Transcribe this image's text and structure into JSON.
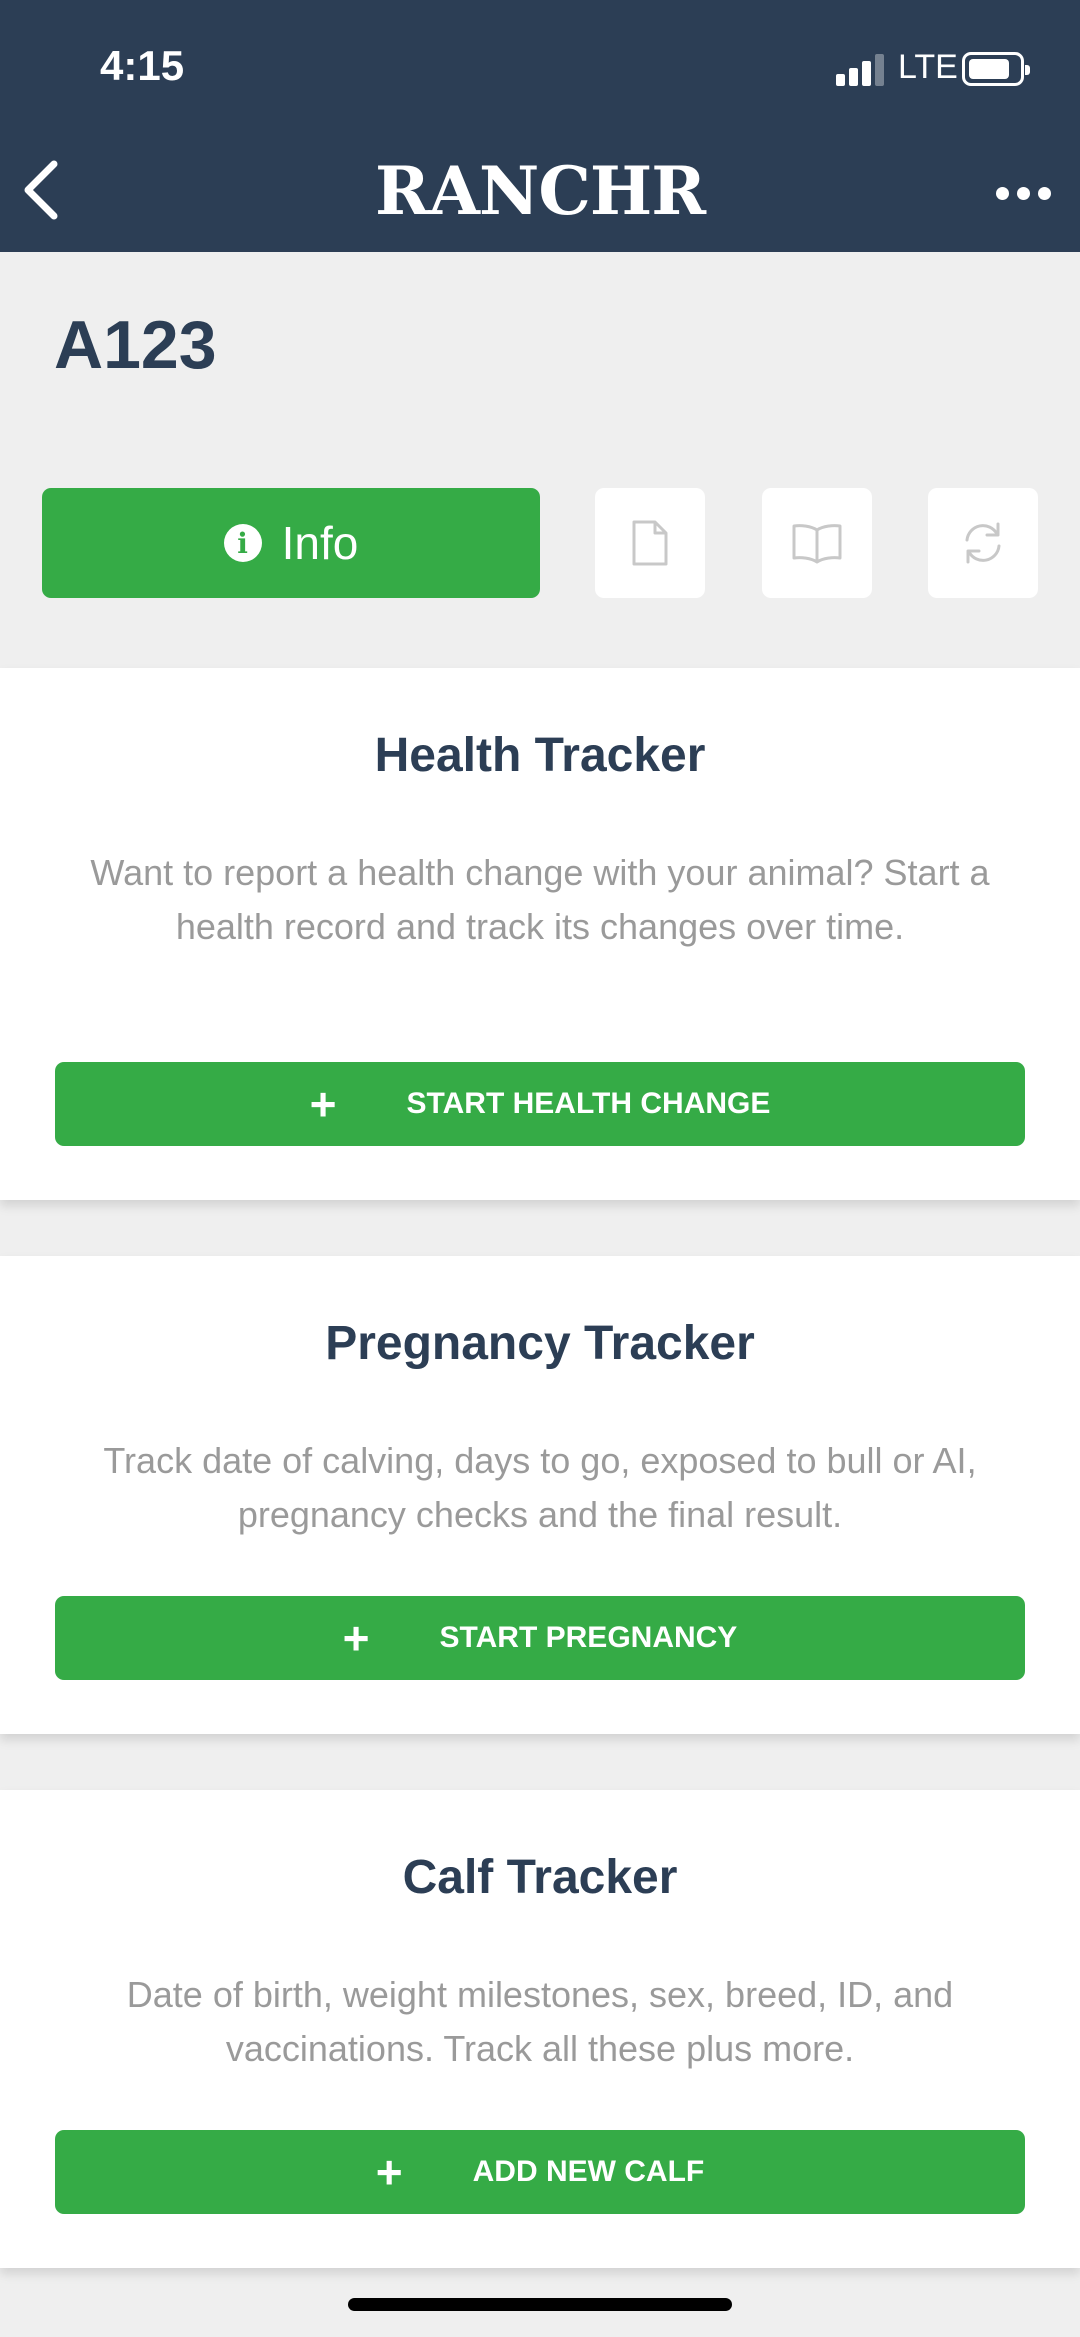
{
  "status_bar": {
    "time": "4:15",
    "network": "LTE"
  },
  "nav": {
    "title": "RANCHR",
    "back_icon": "chevron-left-icon",
    "more_icon": "more-horizontal-icon"
  },
  "animal": {
    "id": "A123"
  },
  "tabs": {
    "info_label": "Info",
    "items": [
      {
        "icon": "document-icon"
      },
      {
        "icon": "book-icon"
      },
      {
        "icon": "refresh-icon"
      }
    ]
  },
  "cards": [
    {
      "title": "Health Tracker",
      "description": "Want to report a health change with your animal? Start a health record and track its changes over time.",
      "button": "START HEALTH CHANGE"
    },
    {
      "title": "Pregnancy Tracker",
      "description": "Track date of calving, days to go, exposed to bull or AI, pregnancy checks and the final result.",
      "button": "START PREGNANCY"
    },
    {
      "title": "Calf Tracker",
      "description": "Date of birth, weight milestones, sex, breed, ID, and vaccinations. Track all these plus more.",
      "button": "ADD NEW CALF"
    }
  ],
  "colors": {
    "header": "#2c3e55",
    "accent": "#35ab46",
    "background": "#efefef"
  }
}
